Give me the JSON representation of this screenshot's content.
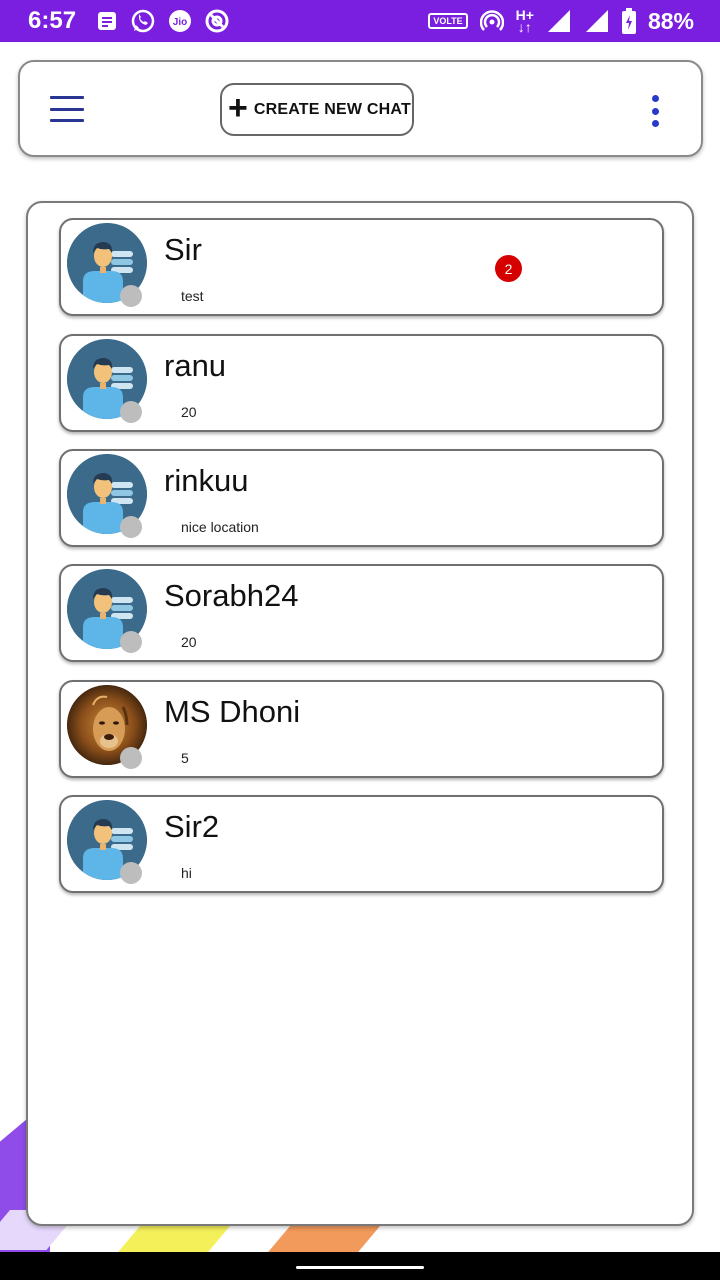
{
  "status_bar": {
    "time": "6:57",
    "volte": "VOLTE",
    "network_type": "H+",
    "battery": "88%",
    "icons": [
      "message-icon",
      "whatsapp-icon",
      "jio-icon",
      "at-icon",
      "volte-icon",
      "hotspot-icon",
      "data-arrows-icon",
      "signal-icon",
      "signal-icon",
      "battery-icon"
    ]
  },
  "toolbar": {
    "menu_icon": "hamburger-menu-icon",
    "create_chat_label": "CREATE NEW CHAT",
    "create_icon": "plus-icon",
    "more_icon": "more-vertical-icon"
  },
  "chats": [
    {
      "name": "Sir",
      "preview": "test",
      "avatar": "default-user-avatar",
      "unread": "2"
    },
    {
      "name": "ranu",
      "preview": "20",
      "avatar": "default-user-avatar"
    },
    {
      "name": "rinkuu",
      "preview": "nice location",
      "avatar": "default-user-avatar"
    },
    {
      "name": "Sorabh24",
      "preview": "20",
      "avatar": "default-user-avatar"
    },
    {
      "name": "MS Dhoni",
      "preview": "5",
      "avatar": "lion-photo-avatar"
    },
    {
      "name": "Sir2",
      "preview": "hi",
      "avatar": "default-user-avatar"
    }
  ],
  "colors": {
    "status_bar": "#7a1fe0",
    "accent_blue": "#2939c9",
    "unread_badge": "#d50000",
    "presence_offline": "#bdbdbd"
  }
}
